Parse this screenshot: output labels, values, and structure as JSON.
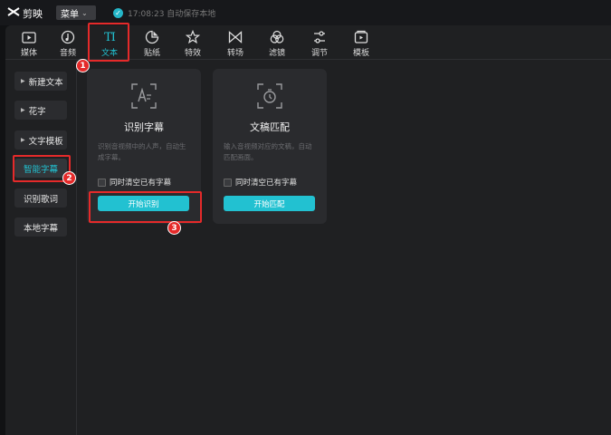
{
  "app": {
    "logo_mark": "ꭗ",
    "name": "剪映"
  },
  "titlebar": {
    "menu_label": "菜单",
    "status_text": "17:08:23 自动保存本地"
  },
  "tabs": [
    {
      "label": "媒体",
      "icon": "media-icon"
    },
    {
      "label": "音频",
      "icon": "audio-icon"
    },
    {
      "label": "文本",
      "icon": "text-icon",
      "glyph": "TI",
      "active": true
    },
    {
      "label": "贴纸",
      "icon": "sticker-icon"
    },
    {
      "label": "特效",
      "icon": "effects-icon"
    },
    {
      "label": "转场",
      "icon": "transition-icon"
    },
    {
      "label": "滤镜",
      "icon": "filter-icon"
    },
    {
      "label": "调节",
      "icon": "adjust-icon"
    },
    {
      "label": "模板",
      "icon": "template-icon"
    }
  ],
  "sidebar": {
    "items": [
      {
        "label": "新建文本",
        "expandable": true
      },
      {
        "label": "花字",
        "expandable": true
      },
      {
        "label": "文字模板",
        "expandable": true
      },
      {
        "label": "智能字幕",
        "active": true
      },
      {
        "label": "识别歌词"
      },
      {
        "label": "本地字幕"
      }
    ]
  },
  "cards": [
    {
      "title": "识别字幕",
      "desc": "识别音视频中的人声，自动生成字幕。",
      "checkbox_label": "同时清空已有字幕",
      "button_label": "开始识别",
      "icon": "recognize-subtitle-icon"
    },
    {
      "title": "文稿匹配",
      "desc": "输入音视频对应的文稿，自动匹配画面。",
      "checkbox_label": "同时清空已有字幕",
      "button_label": "开始匹配",
      "icon": "script-match-icon"
    }
  ],
  "annotations": [
    "1",
    "2",
    "3"
  ],
  "colors": {
    "accent": "#22c1d1",
    "highlight": "#e52a2a",
    "panel": "#1f2022",
    "card": "#2a2b2e"
  }
}
